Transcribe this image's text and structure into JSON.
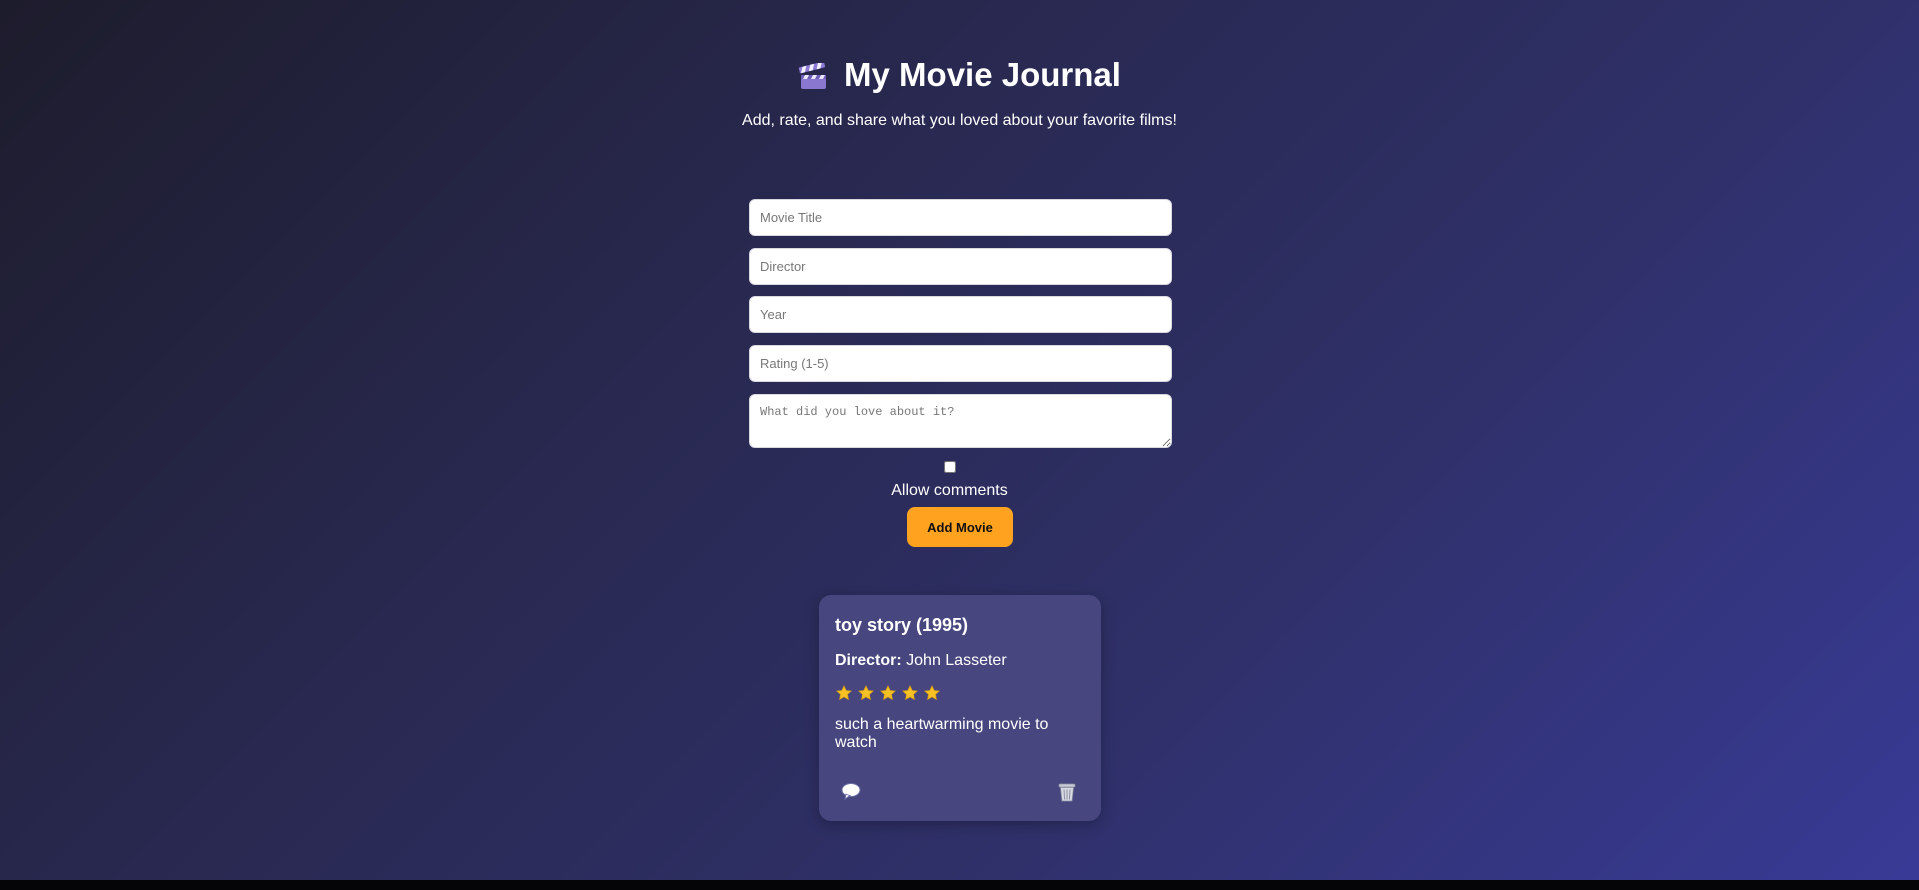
{
  "header": {
    "title": "My Movie Journal",
    "title_icon": "clapperboard-icon",
    "subtitle": "Add, rate, and share what you loved about your favorite films!"
  },
  "form": {
    "title_placeholder": "Movie Title",
    "director_placeholder": "Director",
    "year_placeholder": "Year",
    "rating_placeholder": "Rating (1-5)",
    "review_placeholder": "What did you love about it?",
    "allow_comments_label": "Allow comments",
    "allow_comments_checked": false,
    "submit_label": "Add Movie"
  },
  "movies": [
    {
      "heading": "toy story (1995)",
      "director_label": "Director:",
      "director": "John Lasseter",
      "rating": 5,
      "rating_max": 5,
      "review": "such a heartwarming movie to watch",
      "comment_icon": "speech-bubble-icon",
      "delete_icon": "trash-icon"
    }
  ],
  "colors": {
    "accent": "#ffa220",
    "card_bg": "#47467e",
    "star": "#f5c125"
  }
}
